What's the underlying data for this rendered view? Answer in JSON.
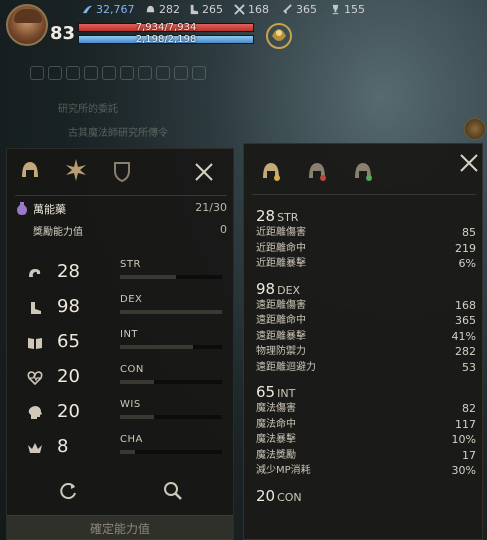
{
  "hud": {
    "level": "83",
    "hp_text": "7,934/7,934",
    "hp_fraction": 1.0,
    "mp_text": "2,198/2,198",
    "mp_fraction": 1.0,
    "resources": [
      {
        "icon": "wing-icon",
        "value": "32,767",
        "color": "#7fb4f0"
      },
      {
        "icon": "helmet-icon",
        "value": "282",
        "color": "#d0d0d0"
      },
      {
        "icon": "boot-icon",
        "value": "265",
        "color": "#d0d0d0"
      },
      {
        "icon": "crossed-swords-icon",
        "value": "168",
        "color": "#d0d0d0"
      },
      {
        "icon": "sword-icon",
        "value": "365",
        "color": "#d0d0d0"
      },
      {
        "icon": "trophy-icon",
        "value": "155",
        "color": "#d0d0d0"
      }
    ]
  },
  "left_panel": {
    "potion_label": "萬能藥",
    "potion_count": "21/30",
    "bonus_label": "獎勵能力值",
    "bonus_value": "0",
    "stats": [
      {
        "value": "28",
        "name": "STR",
        "fill": 0.55
      },
      {
        "value": "98",
        "name": "DEX",
        "fill": 1.0
      },
      {
        "value": "65",
        "name": "INT",
        "fill": 0.72
      },
      {
        "value": "20",
        "name": "CON",
        "fill": 0.33
      },
      {
        "value": "20",
        "name": "WIS",
        "fill": 0.33
      },
      {
        "value": "8",
        "name": "CHA",
        "fill": 0.15
      }
    ],
    "confirm_label": "確定能力值"
  },
  "right_panel": {
    "groups": [
      {
        "value": "28",
        "abbr": "STR",
        "rows": [
          {
            "label": "近距離傷害",
            "value": "85"
          },
          {
            "label": "近距離命中",
            "value": "219"
          },
          {
            "label": "近距離暴擊",
            "value": "6%"
          }
        ]
      },
      {
        "value": "98",
        "abbr": "DEX",
        "rows": [
          {
            "label": "遠距離傷害",
            "value": "168"
          },
          {
            "label": "遠距離命中",
            "value": "365"
          },
          {
            "label": "遠距離暴擊",
            "value": "41%"
          },
          {
            "label": "物理防禦力",
            "value": "282"
          },
          {
            "label": "遠距離迴避力",
            "value": "53"
          }
        ]
      },
      {
        "value": "65",
        "abbr": "INT",
        "rows": [
          {
            "label": "魔法傷害",
            "value": "82"
          },
          {
            "label": "魔法命中",
            "value": "117"
          },
          {
            "label": "魔法暴擊",
            "value": "10%"
          },
          {
            "label": "魔法獎勵",
            "value": "17"
          },
          {
            "label": "減少MP消耗",
            "value": "30%"
          }
        ]
      },
      {
        "value": "20",
        "abbr": "CON",
        "rows": []
      }
    ]
  }
}
